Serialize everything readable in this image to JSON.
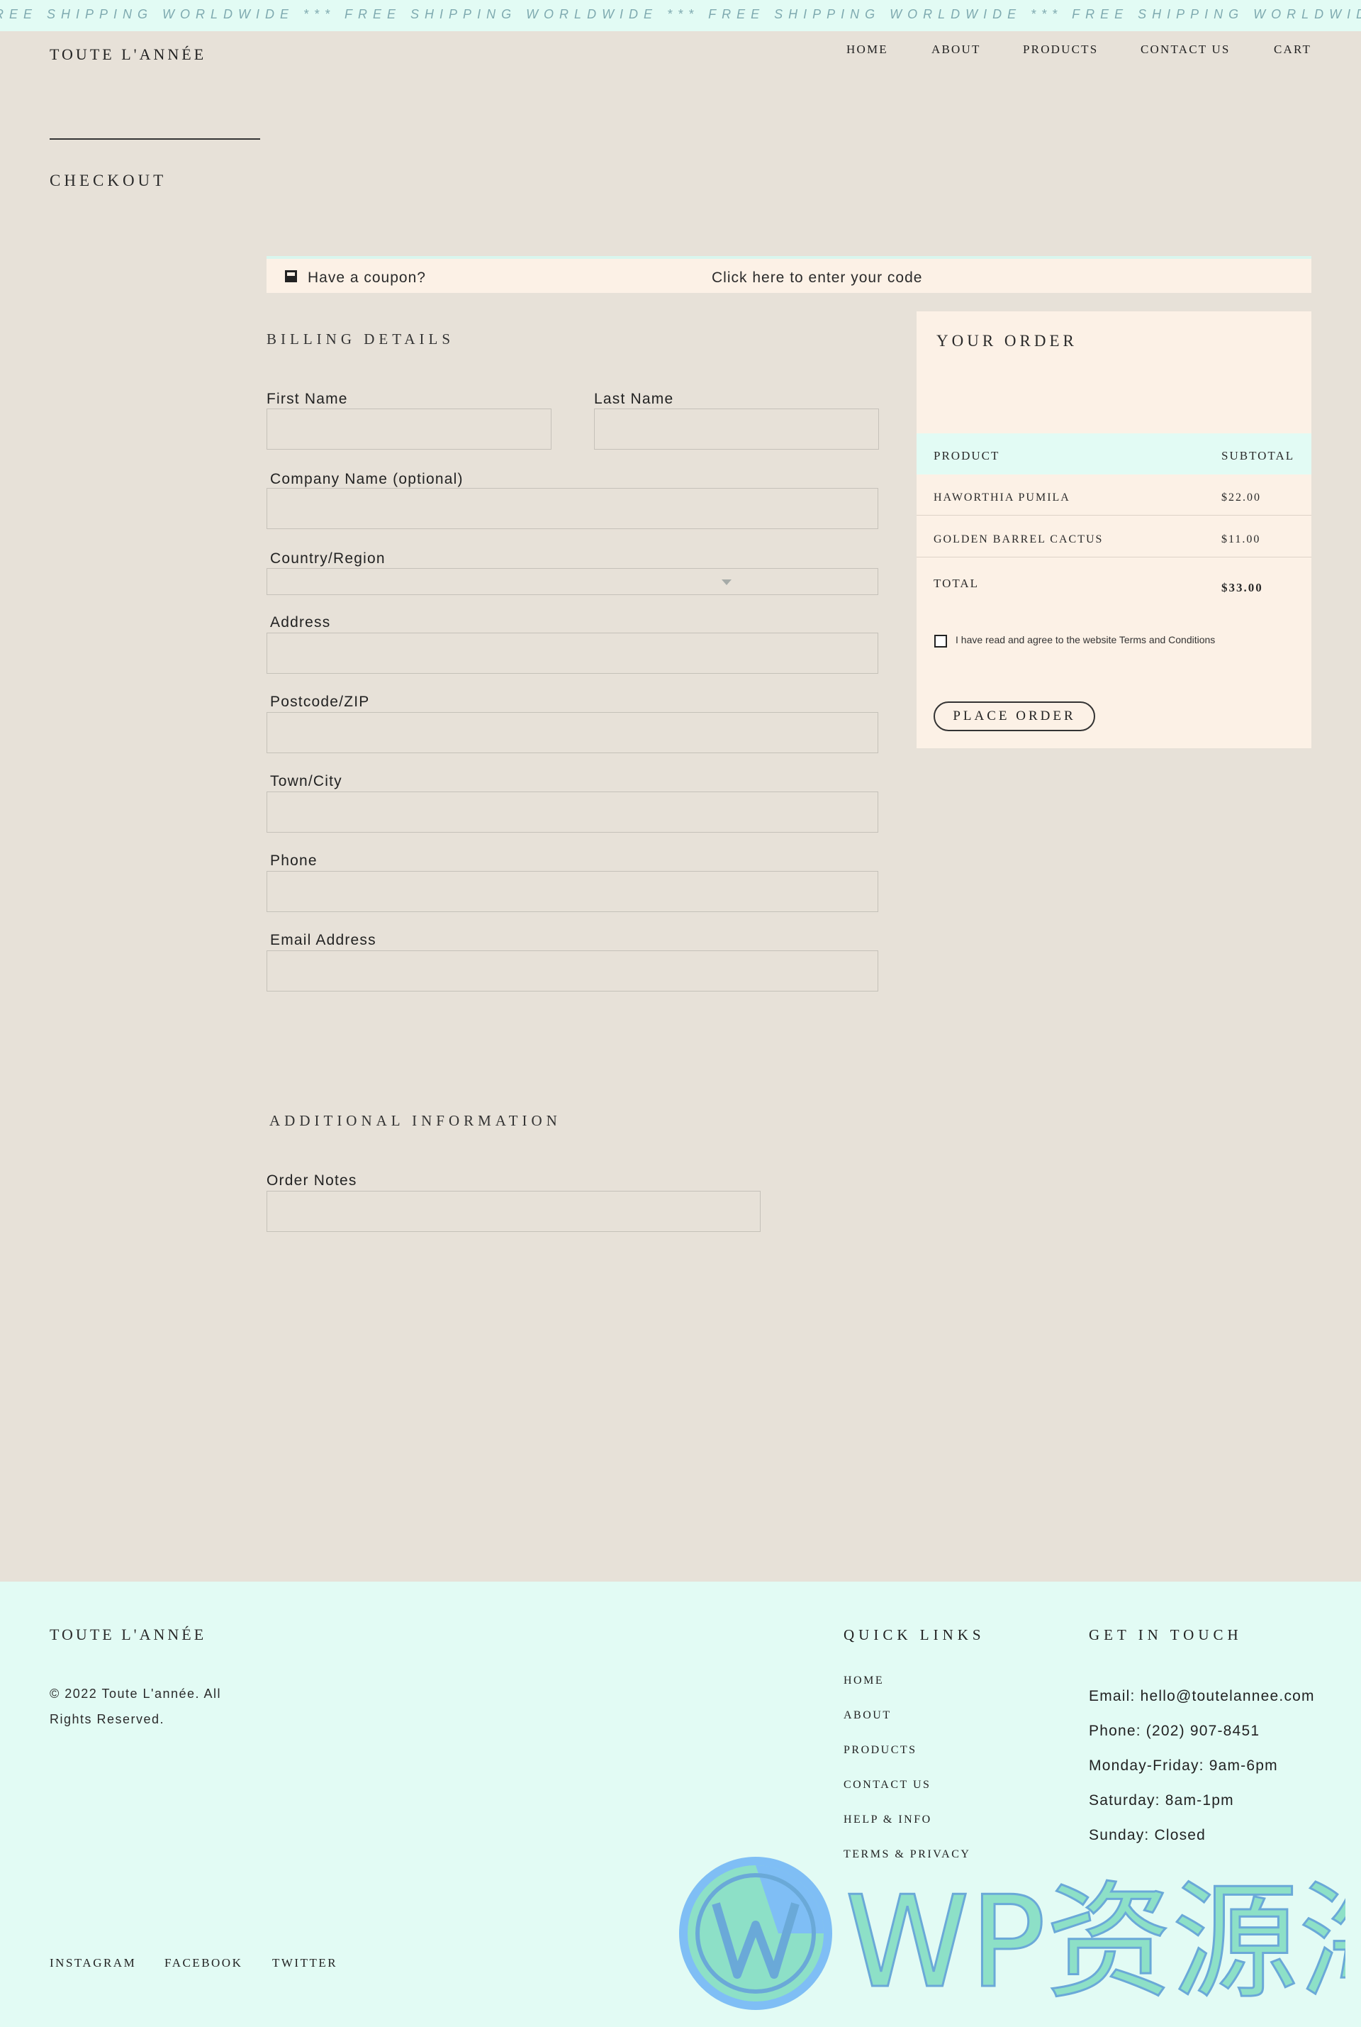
{
  "ticker": {
    "text": "REE SHIPPING WORLDWIDE *** FREE SHIPPING WORLDWIDE *** FREE SHIPPING WORLDWIDE *** FREE SHIPPING WORLDWIDE ***"
  },
  "header": {
    "brand": "TOUTE L'ANNÉE",
    "nav": [
      "HOME",
      "ABOUT",
      "PRODUCTS",
      "CONTACT US",
      "CART"
    ]
  },
  "page": {
    "title": "CHECKOUT"
  },
  "coupon": {
    "prompt": "Have a coupon?",
    "link": "Click here to enter your code",
    "icon": "coupon-icon"
  },
  "billing": {
    "heading": "BILLING DETAILS",
    "first_name": {
      "label": "First Name",
      "value": ""
    },
    "last_name": {
      "label": "Last Name",
      "value": ""
    },
    "company": {
      "label": "Company Name (optional)",
      "value": ""
    },
    "country": {
      "label": "Country/Region",
      "value": ""
    },
    "address": {
      "label": "Address",
      "value": ""
    },
    "postcode": {
      "label": "Postcode/ZIP",
      "value": ""
    },
    "city": {
      "label": "Town/City",
      "value": ""
    },
    "phone": {
      "label": "Phone",
      "value": ""
    },
    "email": {
      "label": "Email Address",
      "value": ""
    }
  },
  "additional": {
    "heading": "ADDITIONAL INFORMATION",
    "notes_label": "Order Notes",
    "notes_value": ""
  },
  "order": {
    "heading": "YOUR ORDER",
    "col_product": "PRODUCT",
    "col_subtotal": "SUBTOTAL",
    "items": [
      {
        "name": "HAWORTHIA PUMILA",
        "price": "$22.00"
      },
      {
        "name": "GOLDEN BARREL CACTUS",
        "price": "$11.00"
      }
    ],
    "total_label": "TOTAL",
    "total_value": "$33.00",
    "terms_text": "I have read and agree to the website Terms and Conditions",
    "terms_checked": false,
    "place_order": "PLACE ORDER"
  },
  "footer": {
    "brand": "TOUTE L'ANNÉE",
    "copyright": "© 2022 Toute L'année. All Rights Reserved.",
    "quick_links_heading": "QUICK LINKS",
    "quick_links": [
      "HOME",
      "ABOUT",
      "PRODUCTS",
      "CONTACT US",
      "HELP & INFO",
      "TERMS & PRIVACY"
    ],
    "contact_heading": "GET IN TOUCH",
    "contact": {
      "email": "Email: hello@toutelannee.com",
      "phone": "Phone: (202) 907-8451",
      "weekdays": "Monday-Friday: 9am-6pm",
      "saturday": "Saturday: 8am-1pm",
      "sunday": "Sunday: Closed"
    },
    "social": [
      "INSTAGRAM",
      "FACEBOOK",
      "TWITTER"
    ]
  },
  "watermark": {
    "text": "WP资源海",
    "icon": "wordpress-logo-icon"
  },
  "colors": {
    "page_bg": "#e7e1d8",
    "mint": "#e2fbf4",
    "cream": "#fcf1e6",
    "ticker_text": "#7faab0",
    "watermark_blue": "#7fbef5",
    "watermark_green": "#8de0c7"
  }
}
